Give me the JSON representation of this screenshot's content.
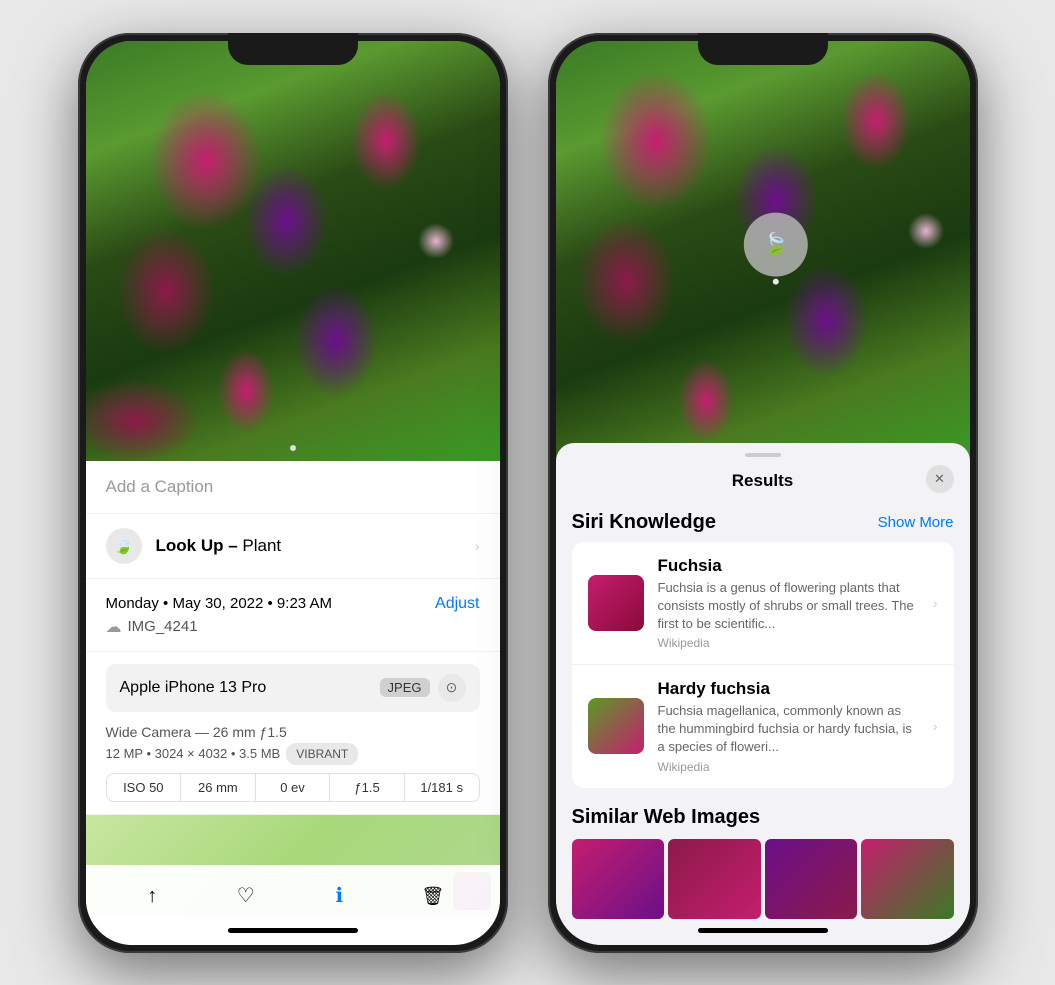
{
  "left_phone": {
    "caption_placeholder": "Add a Caption",
    "lookup_label": "Look Up –",
    "lookup_subject": "Plant",
    "date": "Monday • May 30, 2022 • 9:23 AM",
    "adjust_btn": "Adjust",
    "filename": "IMG_4241",
    "camera_model": "Apple iPhone 13 Pro",
    "format": "JPEG",
    "lens": "Wide Camera — 26 mm ƒ1.5",
    "specs": "12 MP • 3024 × 4032 • 3.5 MB",
    "style": "VIBRANT",
    "iso": "ISO 50",
    "focal": "26 mm",
    "ev": "0 ev",
    "aperture": "ƒ1.5",
    "shutter": "1/181 s",
    "toolbar": {
      "share": "Share",
      "like": "Like",
      "info": "Info",
      "delete": "Delete"
    }
  },
  "right_phone": {
    "results_title": "Results",
    "close_btn": "✕",
    "siri_knowledge_title": "Siri Knowledge",
    "show_more": "Show More",
    "items": [
      {
        "name": "Fuchsia",
        "description": "Fuchsia is a genus of flowering plants that consists mostly of shrubs or small trees. The first to be scientific...",
        "source": "Wikipedia"
      },
      {
        "name": "Hardy fuchsia",
        "description": "Fuchsia magellanica, commonly known as the hummingbird fuchsia or hardy fuchsia, is a species of floweri...",
        "source": "Wikipedia"
      }
    ],
    "similar_title": "Similar Web Images"
  }
}
